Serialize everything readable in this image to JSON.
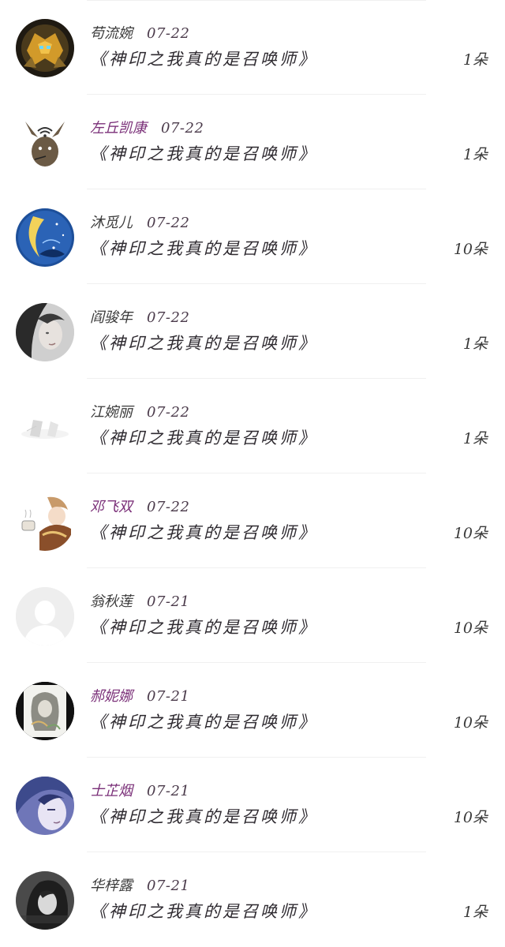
{
  "colors": {
    "name_purple": "#7a2f78",
    "name_dark": "#3a3a3a",
    "divider": "#f0f0f0"
  },
  "items": [
    {
      "name": "苟流婉",
      "date": "07-22",
      "gift": "《神印之我真的是召唤师》",
      "count": "1朵",
      "name_color": "#3a3a3a",
      "avatar": "transformer-robot-avatar"
    },
    {
      "name": "左丘凯康",
      "date": "07-22",
      "gift": "《神印之我真的是召唤师》",
      "count": "1朵",
      "name_color": "#7a2f78",
      "avatar": "rabbit-wifi-avatar"
    },
    {
      "name": "沐觅儿",
      "date": "07-22",
      "gift": "《神印之我真的是召唤师》",
      "count": "10朵",
      "name_color": "#3a3a3a",
      "avatar": "moon-night-avatar"
    },
    {
      "name": "阎骏年",
      "date": "07-22",
      "gift": "《神印之我真的是召唤师》",
      "count": "1朵",
      "name_color": "#3a3a3a",
      "avatar": "girl-portrait-avatar"
    },
    {
      "name": "江婉丽",
      "date": "07-22",
      "gift": "《神印之我真的是召唤师》",
      "count": "1朵",
      "name_color": "#3a3a3a",
      "avatar": "faded-sketch-avatar"
    },
    {
      "name": "邓飞双",
      "date": "07-22",
      "gift": "《神印之我真的是召唤师》",
      "count": "10朵",
      "name_color": "#7a2f78",
      "avatar": "anime-tea-avatar"
    },
    {
      "name": "翁秋莲",
      "date": "07-21",
      "gift": "《神印之我真的是召唤师》",
      "count": "10朵",
      "name_color": "#3a3a3a",
      "avatar": "default-user-avatar"
    },
    {
      "name": "郝妮娜",
      "date": "07-21",
      "gift": "《神印之我真的是召唤师》",
      "count": "10朵",
      "name_color": "#7a2f78",
      "avatar": "girl-sketch-avatar"
    },
    {
      "name": "士芷烟",
      "date": "07-21",
      "gift": "《神印之我真的是召唤师》",
      "count": "10朵",
      "name_color": "#7a2f78",
      "avatar": "anime-face-avatar"
    },
    {
      "name": "华梓露",
      "date": "07-21",
      "gift": "《神印之我真的是召唤师》",
      "count": "1朵",
      "name_color": "#3a3a3a",
      "avatar": "bw-girl-avatar"
    }
  ]
}
